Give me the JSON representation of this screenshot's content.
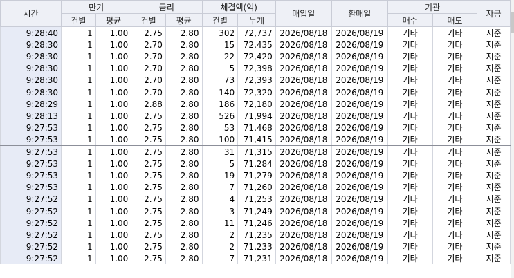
{
  "headers": {
    "time": "시간",
    "maturity": "만기",
    "rate": "금리",
    "volume": "체결액(억)",
    "buy_date": "매입일",
    "sell_date": "환매일",
    "institution": "기관",
    "fund": "자금",
    "sub": {
      "maturity_each": "건별",
      "maturity_avg": "평균",
      "rate_each": "건별",
      "rate_avg": "평균",
      "volume_each": "건별",
      "volume_cum": "누계",
      "inst_buy": "매수",
      "inst_sell": "매도"
    }
  },
  "rows": [
    [
      "9:28:40",
      "1",
      "1.00",
      "2.75",
      "2.80",
      "302",
      "72,737",
      "2026/08/18",
      "2026/08/19",
      "기타",
      "기타",
      "지준"
    ],
    [
      "9:28:30",
      "1",
      "1.00",
      "2.70",
      "2.80",
      "15",
      "72,435",
      "2026/08/18",
      "2026/08/19",
      "기타",
      "기타",
      "지준"
    ],
    [
      "9:28:30",
      "1",
      "1.00",
      "2.70",
      "2.80",
      "22",
      "72,420",
      "2026/08/18",
      "2026/08/19",
      "기타",
      "기타",
      "지준"
    ],
    [
      "9:28:30",
      "1",
      "1.00",
      "2.70",
      "2.80",
      "5",
      "72,398",
      "2026/08/18",
      "2026/08/19",
      "기타",
      "기타",
      "지준"
    ],
    [
      "9:28:30",
      "1",
      "1.00",
      "2.70",
      "2.80",
      "73",
      "72,393",
      "2026/08/18",
      "2026/08/19",
      "기타",
      "기타",
      "지준"
    ],
    [
      "9:28:30",
      "1",
      "1.00",
      "2.70",
      "2.80",
      "140",
      "72,320",
      "2026/08/18",
      "2026/08/19",
      "기타",
      "기타",
      "지준"
    ],
    [
      "9:28:29",
      "1",
      "1.00",
      "2.88",
      "2.80",
      "186",
      "72,180",
      "2026/08/18",
      "2026/08/19",
      "기타",
      "기타",
      "지준"
    ],
    [
      "9:28:13",
      "1",
      "1.00",
      "2.75",
      "2.80",
      "526",
      "71,994",
      "2026/08/18",
      "2026/08/19",
      "기타",
      "기타",
      "지준"
    ],
    [
      "9:27:53",
      "1",
      "1.00",
      "2.75",
      "2.80",
      "53",
      "71,468",
      "2026/08/18",
      "2026/08/19",
      "기타",
      "기타",
      "지준"
    ],
    [
      "9:27:53",
      "1",
      "1.00",
      "2.75",
      "2.80",
      "100",
      "71,415",
      "2026/08/18",
      "2026/08/19",
      "기타",
      "기타",
      "지준"
    ],
    [
      "9:27:53",
      "1",
      "1.00",
      "2.75",
      "2.80",
      "31",
      "71,315",
      "2026/08/18",
      "2026/08/19",
      "기타",
      "기타",
      "지준"
    ],
    [
      "9:27:53",
      "1",
      "1.00",
      "2.75",
      "2.80",
      "5",
      "71,284",
      "2026/08/18",
      "2026/08/19",
      "기타",
      "기타",
      "지준"
    ],
    [
      "9:27:53",
      "1",
      "1.00",
      "2.75",
      "2.80",
      "19",
      "71,279",
      "2026/08/18",
      "2026/08/19",
      "기타",
      "기타",
      "지준"
    ],
    [
      "9:27:53",
      "1",
      "1.00",
      "2.75",
      "2.80",
      "7",
      "71,260",
      "2026/08/18",
      "2026/08/19",
      "기타",
      "기타",
      "지준"
    ],
    [
      "9:27:52",
      "1",
      "1.00",
      "2.75",
      "2.80",
      "4",
      "71,253",
      "2026/08/18",
      "2026/08/19",
      "기타",
      "기타",
      "지준"
    ],
    [
      "9:27:52",
      "1",
      "1.00",
      "2.75",
      "2.80",
      "3",
      "71,249",
      "2026/08/18",
      "2026/08/19",
      "기타",
      "기타",
      "지준"
    ],
    [
      "9:27:52",
      "1",
      "1.00",
      "2.75",
      "2.80",
      "11",
      "71,246",
      "2026/08/18",
      "2026/08/19",
      "기타",
      "기타",
      "지준"
    ],
    [
      "9:27:52",
      "1",
      "1.00",
      "2.75",
      "2.80",
      "2",
      "71,235",
      "2026/08/18",
      "2026/08/19",
      "기타",
      "기타",
      "지준"
    ],
    [
      "9:27:52",
      "1",
      "1.00",
      "2.75",
      "2.80",
      "2",
      "71,233",
      "2026/08/18",
      "2026/08/19",
      "기타",
      "기타",
      "지준"
    ],
    [
      "9:27:52",
      "1",
      "1.00",
      "2.75",
      "2.80",
      "7",
      "71,231",
      "2026/08/18",
      "2026/08/19",
      "기타",
      "기타",
      "지준"
    ]
  ],
  "colors": {
    "header_bg": "#eef0f6",
    "time_bg": "#e7ebf6",
    "group_line": "#8c8f99"
  }
}
